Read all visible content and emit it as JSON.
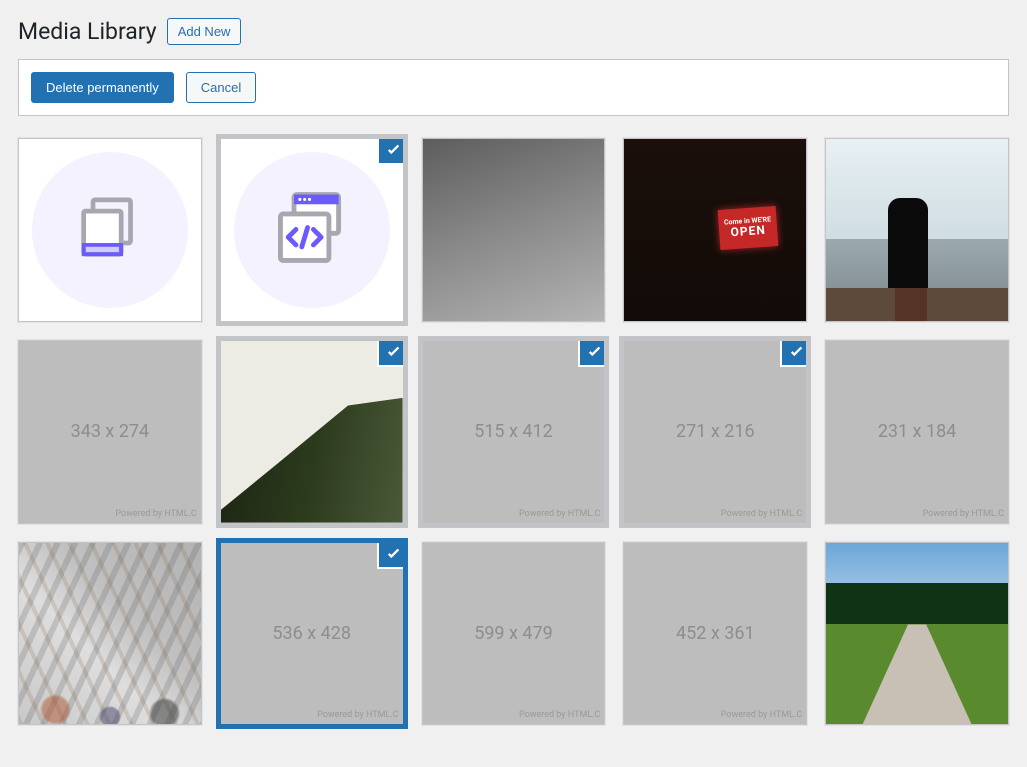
{
  "header": {
    "title": "Media Library",
    "add_new": "Add New"
  },
  "actions": {
    "delete": "Delete permanently",
    "cancel": "Cancel"
  },
  "placeholder_watermark": "Powered by HTML.C",
  "open_sign": {
    "small": "Come in WE'RE",
    "big": "OPEN"
  },
  "tiles": [
    {
      "kind": "icon-docs",
      "selected": false
    },
    {
      "kind": "icon-code",
      "selected": true,
      "sel_style": "grey"
    },
    {
      "kind": "dark-gradient",
      "selected": false
    },
    {
      "kind": "photo-store",
      "selected": false
    },
    {
      "kind": "photo-lake",
      "selected": false
    },
    {
      "kind": "placeholder",
      "label": "343 x 274",
      "selected": false
    },
    {
      "kind": "photo-hill",
      "selected": true,
      "sel_style": "grey"
    },
    {
      "kind": "placeholder",
      "label": "515 x 412",
      "selected": true,
      "sel_style": "grey"
    },
    {
      "kind": "placeholder",
      "label": "271 x 216",
      "selected": true,
      "sel_style": "grey"
    },
    {
      "kind": "placeholder",
      "label": "231 x 184",
      "selected": false
    },
    {
      "kind": "photo-mall",
      "selected": false
    },
    {
      "kind": "placeholder",
      "label": "536 x 428",
      "selected": true,
      "sel_style": "blue"
    },
    {
      "kind": "placeholder",
      "label": "599 x 479",
      "selected": false
    },
    {
      "kind": "placeholder",
      "label": "452 x 361",
      "selected": false
    },
    {
      "kind": "photo-park",
      "selected": false
    }
  ]
}
